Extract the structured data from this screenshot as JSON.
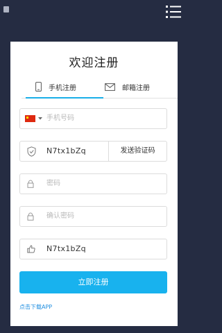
{
  "page": {
    "title": "欢迎注册"
  },
  "tabs": [
    {
      "label": "手机注册",
      "icon": "phone-icon",
      "active": true
    },
    {
      "label": "邮箱注册",
      "icon": "mail-icon",
      "active": false
    }
  ],
  "form": {
    "phone_placeholder": "手机号码",
    "country_icon": "china-flag-icon",
    "captcha_value": "N7tx1bZq",
    "send_code_label": "发送验证码",
    "password_placeholder": "密码",
    "confirm_placeholder": "确认密码",
    "invite_value": "N7tx1bZq"
  },
  "actions": {
    "submit_label": "立即注册",
    "download_label": "点击下载APP"
  },
  "colors": {
    "background": "#252c42",
    "accent": "#18b2ee",
    "link": "#1f8ee0"
  }
}
